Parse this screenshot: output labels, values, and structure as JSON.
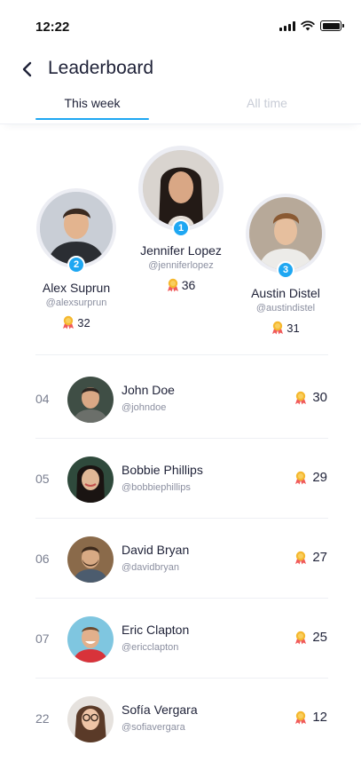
{
  "status_bar": {
    "time": "12:22"
  },
  "header": {
    "title": "Leaderboard"
  },
  "tabs": [
    {
      "label": "This week",
      "active": true
    },
    {
      "label": "All time",
      "active": false
    }
  ],
  "podium": [
    {
      "rank": "1",
      "name": "Jennifer Lopez",
      "handle": "@jenniferlopez",
      "score": "36"
    },
    {
      "rank": "2",
      "name": "Alex Suprun",
      "handle": "@alexsurprun",
      "score": "32"
    },
    {
      "rank": "3",
      "name": "Austin Distel",
      "handle": "@austindistel",
      "score": "31"
    }
  ],
  "leaderboard": [
    {
      "rank": "04",
      "name": "John Doe",
      "handle": "@johndoe",
      "score": "30"
    },
    {
      "rank": "05",
      "name": "Bobbie Phillips",
      "handle": "@bobbiephillips",
      "score": "29"
    },
    {
      "rank": "06",
      "name": "David Bryan",
      "handle": "@davidbryan",
      "score": "27"
    },
    {
      "rank": "07",
      "name": "Eric Clapton",
      "handle": "@ericclapton",
      "score": "25"
    },
    {
      "rank": "22",
      "name": "Sofía Vergara",
      "handle": "@sofiavergara",
      "score": "12"
    }
  ],
  "colors": {
    "accent": "#1ea7f2",
    "text": "#1f2238",
    "muted": "#8b8fa0",
    "medal_ribbon": "#f05a5a",
    "medal_gold": "#f5b82e"
  },
  "icons": {
    "back": "chevron-left-icon",
    "medal": "medal-icon"
  }
}
